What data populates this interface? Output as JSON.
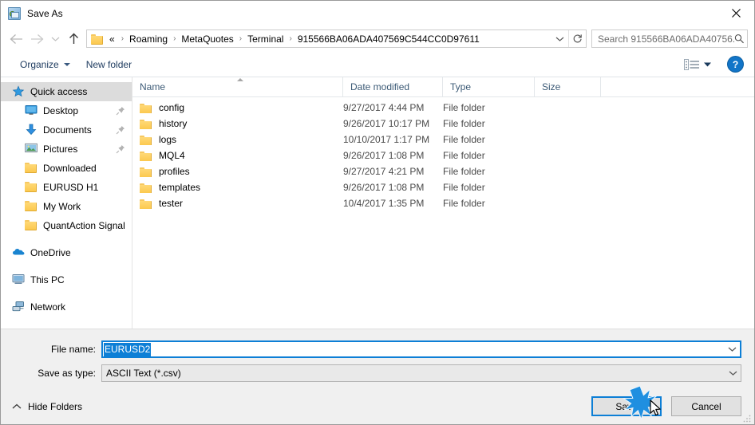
{
  "window": {
    "title": "Save As",
    "icon": "save-as-app-icon",
    "close_label": "✕"
  },
  "nav": {
    "back_icon": "arrow-left-icon",
    "forward_icon": "arrow-right-icon",
    "recent_icon": "chevron-down-icon",
    "up_icon": "arrow-up-icon",
    "address": {
      "folder_icon": "folder-icon",
      "prefix": "«",
      "crumbs": [
        "Roaming",
        "MetaQuotes",
        "Terminal",
        "915566BA06ADA407569C544CC0D97611"
      ],
      "separator": "›",
      "dropdown_icon": "chevron-down-icon",
      "refresh_icon": "refresh-icon"
    },
    "search": {
      "placeholder": "Search 915566BA06ADA40756...",
      "icon": "search-icon"
    }
  },
  "commandbar": {
    "organize_label": "Organize",
    "new_folder_label": "New folder",
    "view_icon": "view-options-icon",
    "view_dropdown_icon": "chevron-down-icon",
    "help_label": "?",
    "help_icon": "help-icon"
  },
  "sidebar": {
    "items": [
      {
        "label": "Quick access",
        "icon": "star-icon",
        "selected": true,
        "level": "root",
        "pinned": false
      },
      {
        "label": "Desktop",
        "icon": "desktop-icon",
        "selected": false,
        "level": "child",
        "pinned": true
      },
      {
        "label": "Documents",
        "icon": "documents-icon",
        "selected": false,
        "level": "child",
        "pinned": true
      },
      {
        "label": "Pictures",
        "icon": "pictures-icon",
        "selected": false,
        "level": "child",
        "pinned": true
      },
      {
        "label": "Downloaded",
        "icon": "folder-icon",
        "selected": false,
        "level": "child",
        "pinned": false
      },
      {
        "label": "EURUSD H1",
        "icon": "folder-icon",
        "selected": false,
        "level": "child",
        "pinned": false
      },
      {
        "label": "My Work",
        "icon": "folder-icon",
        "selected": false,
        "level": "child",
        "pinned": false
      },
      {
        "label": "QuantAction Signal",
        "icon": "folder-icon",
        "selected": false,
        "level": "child",
        "pinned": false
      },
      {
        "label": "OneDrive",
        "icon": "onedrive-icon",
        "selected": false,
        "level": "root",
        "pinned": false
      },
      {
        "label": "This PC",
        "icon": "this-pc-icon",
        "selected": false,
        "level": "root",
        "pinned": false
      },
      {
        "label": "Network",
        "icon": "network-icon",
        "selected": false,
        "level": "root",
        "pinned": false
      }
    ]
  },
  "filelist": {
    "columns": [
      "Name",
      "Date modified",
      "Type",
      "Size"
    ],
    "sort_column": "Name",
    "sort_direction": "ascending",
    "rows": [
      {
        "name": "config",
        "date": "9/27/2017 4:44 PM",
        "type": "File folder",
        "size": ""
      },
      {
        "name": "history",
        "date": "9/26/2017 10:17 PM",
        "type": "File folder",
        "size": ""
      },
      {
        "name": "logs",
        "date": "10/10/2017 1:17 PM",
        "type": "File folder",
        "size": ""
      },
      {
        "name": "MQL4",
        "date": "9/26/2017 1:08 PM",
        "type": "File folder",
        "size": ""
      },
      {
        "name": "profiles",
        "date": "9/27/2017 4:21 PM",
        "type": "File folder",
        "size": ""
      },
      {
        "name": "templates",
        "date": "9/26/2017 1:08 PM",
        "type": "File folder",
        "size": ""
      },
      {
        "name": "tester",
        "date": "10/4/2017 1:35 PM",
        "type": "File folder",
        "size": ""
      }
    ]
  },
  "form": {
    "filename_label": "File name:",
    "filename_value": "EURUSD2",
    "filetype_label": "Save as type:",
    "filetype_value": "ASCII Text (*.csv)",
    "dropdown_icon": "chevron-down-icon"
  },
  "footer": {
    "hide_folders_label": "Hide Folders",
    "hide_folders_icon": "chevron-up-icon",
    "save_label": "Save",
    "cancel_label": "Cancel"
  },
  "overlay": {
    "click_burst_color": "#1f8fe0",
    "cursor_icon": "mouse-pointer-icon"
  },
  "colors": {
    "accent": "#0d7fd6",
    "folder": "#fcc94f",
    "help_blue": "#1275c8",
    "selection": "#dcdcdc"
  }
}
